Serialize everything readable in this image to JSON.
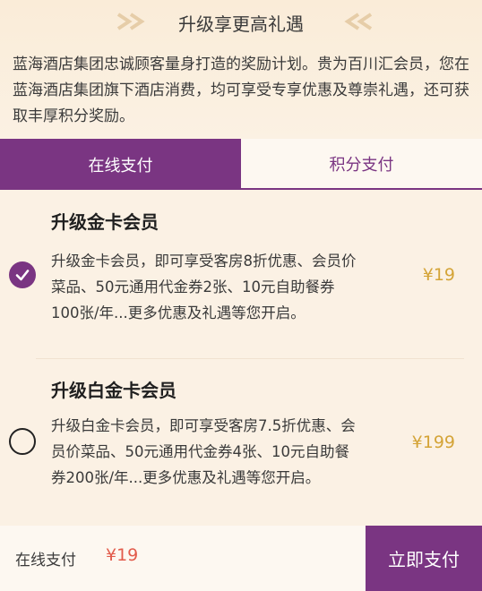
{
  "header": {
    "title": "升级享更高礼遇",
    "description": "蓝海酒店集团忠诚顾客量身打造的奖励计划。贵为百川汇会员，您在蓝海酒店集团旗下酒店消费，均可享受专享优惠及尊崇礼遇，还可获取丰厚积分奖励。"
  },
  "tabs": [
    {
      "label": "在线支付",
      "active": true
    },
    {
      "label": "积分支付",
      "active": false
    }
  ],
  "plans": [
    {
      "title": "升级金卡会员",
      "description": "升级金卡会员，即可享受客房8折优惠、会员价菜品、50元通用代金券2张、10元自助餐券100张/年...更多优惠及礼遇等您开启。",
      "price": "¥19",
      "selected": true
    },
    {
      "title": "升级白金卡会员",
      "description": "升级白金卡会员，即可享受客房7.5折优惠、会员价菜品、50元通用代金券4张、10元自助餐券200张/年...更多优惠及礼遇等您开启。",
      "price": "¥199",
      "selected": false
    }
  ],
  "footer": {
    "label": "在线支付",
    "amount": "¥19",
    "pay_label": "立即支付"
  },
  "colors": {
    "accent": "#7a3582",
    "price": "#d4a437",
    "amount": "#e25b4b",
    "background": "#fbf1e4"
  },
  "icons": {
    "checked": "check-circle-icon",
    "unchecked": "circle-outline-icon",
    "decoration": "chevron-decoration-icon"
  }
}
